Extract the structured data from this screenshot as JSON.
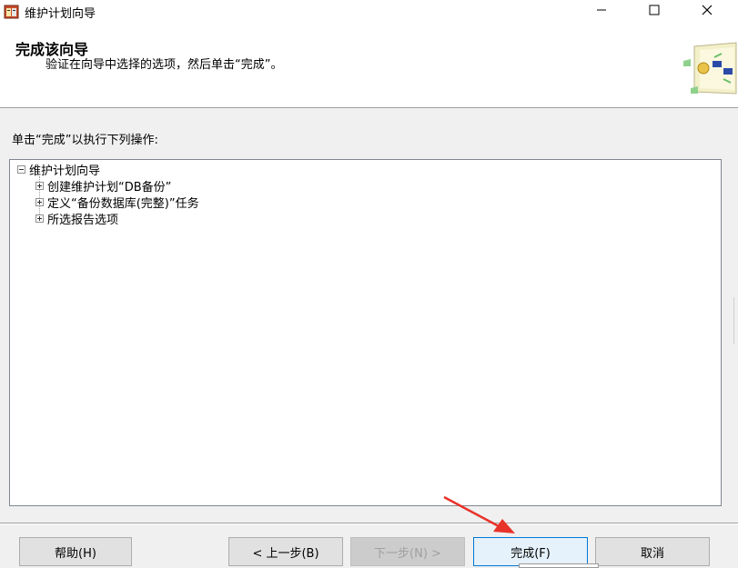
{
  "window": {
    "title": "维护计划向导"
  },
  "header": {
    "title": "完成该向导",
    "subtitle": "验证在向导中选择的选项，然后单击“完成”。"
  },
  "main": {
    "instruction": "单击“完成”以执行下列操作:",
    "tree": {
      "root": "维护计划向导",
      "children": [
        "创建维护计划“DB备份”",
        "定义“备份数据库(完整)”任务",
        "所选报告选项"
      ]
    }
  },
  "footer": {
    "help_label": "帮助(H)",
    "back_label": "< 上一步(B)",
    "next_label": "下一步(N) >",
    "finish_label": "完成(F)",
    "cancel_label": "取消"
  },
  "colors": {
    "accent": "#0078d7",
    "arrow": "#e8332a"
  }
}
